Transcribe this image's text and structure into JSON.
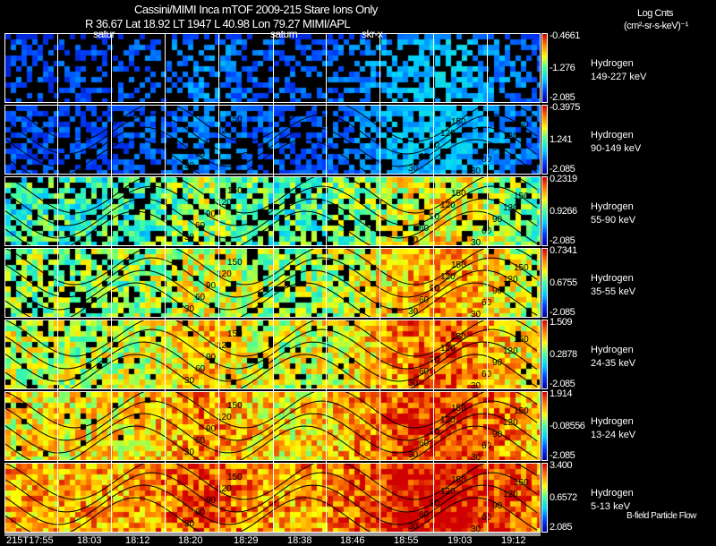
{
  "header": {
    "title": "Cassini/MIMI Inca mTOF  2009-215   Stare   Ions Only",
    "ephemeris": "R        36.67 Lat 18.92 LT 1947 L          40.98 Lon          79.27  MIMI/APL",
    "units_line1": "Log Cnts",
    "units_line2": "(cm²-sr-s-keV)⁻¹"
  },
  "annotations": [
    "satur",
    "saturn",
    "skr-x"
  ],
  "footer": {
    "legend": "B-field Particle Flow"
  },
  "chart_data": {
    "type": "heatmap",
    "title": "Cassini/MIMI Inca mTOF  2009-215   Stare   Ions Only",
    "x_ticks": [
      "215T17:55",
      "18:03",
      "18:12",
      "18:20",
      "18:29",
      "18:38",
      "18:46",
      "18:55",
      "19:03",
      "19:12"
    ],
    "contour_levels": [
      "30",
      "60",
      "90",
      "120",
      "150"
    ],
    "colorscale": [
      "#0000a0",
      "#0040ff",
      "#00d0ff",
      "#40ffa0",
      "#ffff00",
      "#ff8000",
      "#d00000"
    ],
    "panels": [
      {
        "species": "Hydrogen",
        "energy": "149-227 keV",
        "cmax": "-0.4661",
        "cmid": "-1.276",
        "cmin": "-2.085"
      },
      {
        "species": "Hydrogen",
        "energy": "90-149 keV",
        "cmax": "-0.3975",
        "cmid": "1.241",
        "cmin": "-2.085"
      },
      {
        "species": "Hydrogen",
        "energy": "55-90 keV",
        "cmax": "0.2319",
        "cmid": "0.9266",
        "cmin": "-2.085"
      },
      {
        "species": "Hydrogen",
        "energy": "35-55 keV",
        "cmax": "0.7341",
        "cmid": "0.6755",
        "cmin": "-2.085"
      },
      {
        "species": "Hydrogen",
        "energy": "24-35 keV",
        "cmax": "1.509",
        "cmid": "0.2878",
        "cmin": "-2.085"
      },
      {
        "species": "Hydrogen",
        "energy": "13-24 keV",
        "cmax": "1.914",
        "cmid": "-0.08556",
        "cmin": "-2.085"
      },
      {
        "species": "Hydrogen",
        "energy": "5-13 keV",
        "cmax": "3.400",
        "cmid": "0.6572",
        "cmin": "2.085"
      }
    ]
  }
}
